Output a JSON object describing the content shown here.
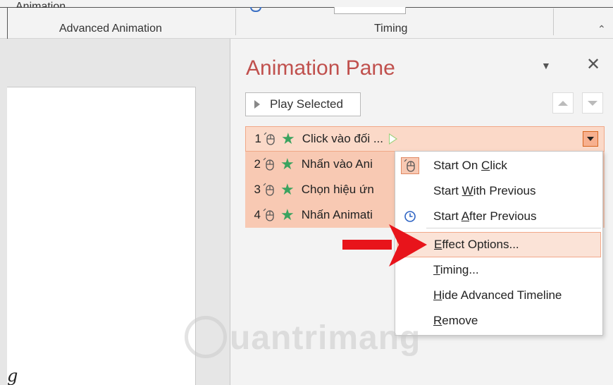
{
  "ribbon": {
    "cut_text": "Animation",
    "group_advanced": "Advanced Animation",
    "group_timing": "Timing",
    "collapse_glyph": "⌃"
  },
  "slide": {
    "text_fragment": "g"
  },
  "pane": {
    "title": "Animation Pane",
    "dropdown_glyph": "▼",
    "close_glyph": "✕",
    "play_selected": "Play Selected",
    "items": [
      {
        "num": "1",
        "label": "Click vào đối ...",
        "selected": true
      },
      {
        "num": "2",
        "label": "Nhấn vào Ani"
      },
      {
        "num": "3",
        "label": "Chọn hiệu ứn"
      },
      {
        "num": "4",
        "label": "Nhấn Animati"
      }
    ],
    "star_glyph": "★"
  },
  "menu": {
    "items": [
      {
        "pre": "Start On ",
        "key": "C",
        "post": "lick",
        "icon": "mouse-click-icon",
        "checked": true
      },
      {
        "pre": "Start ",
        "key": "W",
        "post": "ith Previous",
        "icon": ""
      },
      {
        "pre": "Start ",
        "key": "A",
        "post": "fter Previous",
        "icon": "clock-icon"
      },
      {
        "pre": "",
        "key": "E",
        "post": "ffect Options...",
        "highlighted": true
      },
      {
        "pre": "",
        "key": "T",
        "post": "iming..."
      },
      {
        "pre": "",
        "key": "H",
        "post": "ide Advanced Timeline"
      },
      {
        "pre": "",
        "key": "R",
        "post": "emove"
      }
    ]
  },
  "watermark": {
    "text": "uantrimang"
  },
  "colors": {
    "title": "#c0504d",
    "selection": "#f8c9b3",
    "arrow": "#e8141b",
    "star": "#3aa35f"
  }
}
